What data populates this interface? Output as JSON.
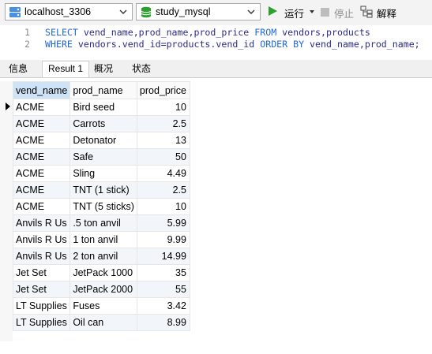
{
  "toolbar": {
    "connection": "localhost_3306",
    "database": "study_mysql",
    "run_label": "运行",
    "stop_label": "停止",
    "explain_label": "解释"
  },
  "editor": {
    "lines": [
      {
        "no": "1",
        "text_parts": [
          {
            "t": "SELECT",
            "kw": true
          },
          {
            "t": " vend_name,prod_name,prod_price ",
            "kw": false
          },
          {
            "t": "FROM",
            "kw": true
          },
          {
            "t": " vendors,products",
            "kw": false
          }
        ]
      },
      {
        "no": "2",
        "text_parts": [
          {
            "t": "WHERE",
            "kw": true
          },
          {
            "t": " vendors.vend_id=products.vend_id ",
            "kw": false
          },
          {
            "t": "ORDER BY",
            "kw": true
          },
          {
            "t": " vend_name,prod_name;",
            "kw": false
          }
        ]
      }
    ]
  },
  "tabs": [
    "信息",
    "Result 1",
    "概况",
    "状态"
  ],
  "active_tab": "Result 1",
  "grid": {
    "columns": [
      "vend_name",
      "prod_name",
      "prod_price"
    ],
    "rows": [
      [
        "ACME",
        "Bird seed",
        "10"
      ],
      [
        "ACME",
        "Carrots",
        "2.5"
      ],
      [
        "ACME",
        "Detonator",
        "13"
      ],
      [
        "ACME",
        "Safe",
        "50"
      ],
      [
        "ACME",
        "Sling",
        "4.49"
      ],
      [
        "ACME",
        "TNT (1 stick)",
        "2.5"
      ],
      [
        "ACME",
        "TNT (5 sticks)",
        "10"
      ],
      [
        "Anvils R Us",
        ".5 ton anvil",
        "5.99"
      ],
      [
        "Anvils R Us",
        "1 ton anvil",
        "9.99"
      ],
      [
        "Anvils R Us",
        "2 ton anvil",
        "14.99"
      ],
      [
        "Jet Set",
        "JetPack 1000",
        "35"
      ],
      [
        "Jet Set",
        "JetPack 2000",
        "55"
      ],
      [
        "LT Supplies",
        "Fuses",
        "3.42"
      ],
      [
        "LT Supplies",
        "Oil can",
        "8.99"
      ]
    ]
  },
  "colors": {
    "run_icon": "#2ca02c",
    "sql_keyword": "#1f66d6",
    "selected_header": "#cfe3f7",
    "alt_row": "#f2f6fb"
  }
}
